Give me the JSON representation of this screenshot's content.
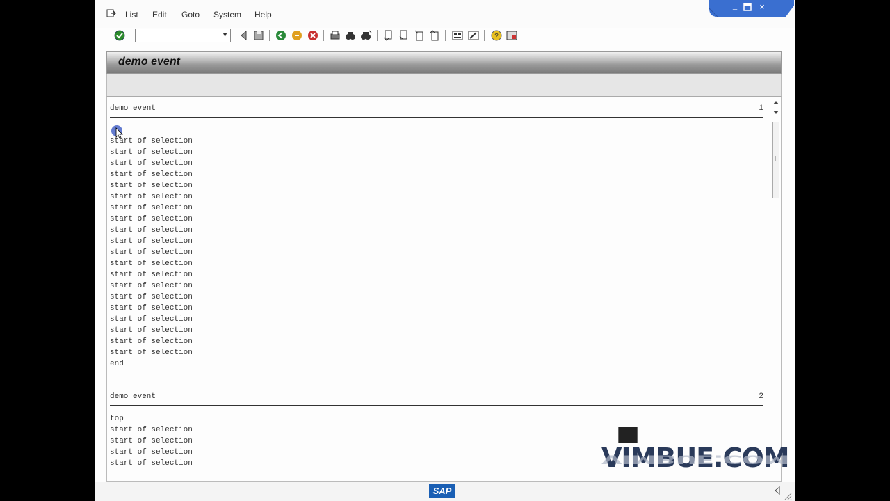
{
  "menu": {
    "items": [
      {
        "label": "List"
      },
      {
        "label": "Edit"
      },
      {
        "label": "Goto"
      },
      {
        "label": "System"
      },
      {
        "label": "Help"
      }
    ]
  },
  "toolbar": {
    "command_field_value": "",
    "icons": [
      "enter-icon",
      "back-icon",
      "save-icon",
      "green-back-icon",
      "exit-icon",
      "cancel-icon",
      "print-icon",
      "find-icon",
      "find-next-icon",
      "first-page-icon",
      "previous-page-icon",
      "next-page-icon",
      "last-page-icon",
      "create-session-icon",
      "shortcut-icon",
      "help-icon",
      "layout-icon"
    ]
  },
  "screen": {
    "title": "demo event"
  },
  "pages": [
    {
      "header": "demo event",
      "page_number": "1",
      "lines": [
        "start of selection",
        "start of selection",
        "start of selection",
        "start of selection",
        "start of selection",
        "start of selection",
        "start of selection",
        "start of selection",
        "start of selection",
        "start of selection",
        "start of selection",
        "start of selection",
        "start of selection",
        "start of selection",
        "start of selection",
        "start of selection",
        "start of selection",
        "start of selection",
        "start of selection",
        "start of selection",
        "end"
      ]
    },
    {
      "header": "demo event",
      "page_number": "2",
      "lines": [
        "top",
        "start of selection",
        "start of selection",
        "start of selection",
        "start of selection"
      ]
    }
  ],
  "status": {
    "logo": "SAP"
  },
  "watermark": "VIMBUE.COM",
  "colors": {
    "window_control_blue": "#3a6fd0",
    "sap_blue": "#1a5fb4"
  }
}
